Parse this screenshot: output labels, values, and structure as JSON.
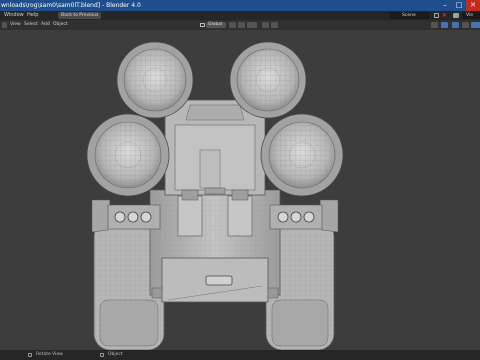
{
  "window": {
    "title": "wnloads\\rog\\sam0\\sam0lT.blend] - Blender 4.0",
    "minimize": "–",
    "maximize": "□",
    "close": "✕"
  },
  "menubar": {
    "items": [
      "Window",
      "Help"
    ],
    "back_label": "Back to Previous",
    "scene_label": "Scene",
    "view_layer_label": "Vie"
  },
  "header": {
    "items": [
      "View",
      "Select",
      "Add",
      "Object"
    ],
    "transform_orientation": "Global"
  },
  "statusbar": {
    "left_label": "Rotate View",
    "right_label": "Object"
  },
  "icons": {
    "scene": "scene-icon",
    "view_layer": "view-layer-icon",
    "snap": "magnet-icon",
    "pivot": "pivot-icon",
    "overlays": "overlays-icon",
    "xray": "xray-icon",
    "shading": "shading-icon",
    "mouse": "mouse-icon"
  },
  "colors": {
    "title_bar": "#1e4f8c",
    "accent": "#4772b3",
    "viewport_bg": "#3d3d3d",
    "mesh": "#bdbdbd"
  }
}
